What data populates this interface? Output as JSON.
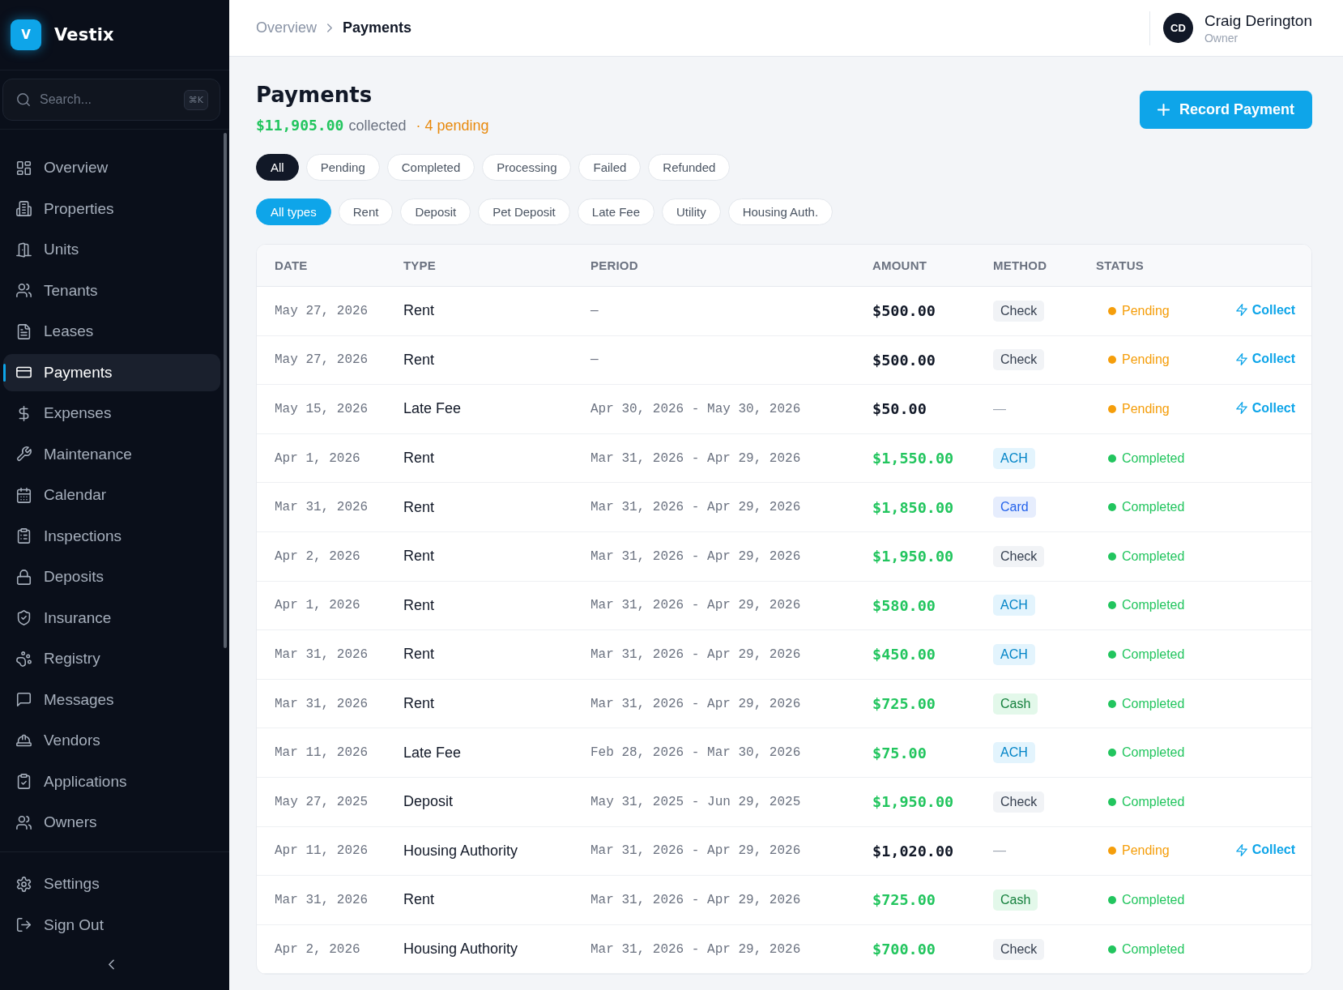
{
  "sidebar": {
    "logo": {
      "mark": "V",
      "name": "Vestix"
    },
    "search": {
      "placeholder": "Search...",
      "shortcut": "⌘K"
    },
    "nav": [
      {
        "label": "Overview",
        "selected": false
      },
      {
        "label": "Properties",
        "selected": false
      },
      {
        "label": "Units",
        "selected": false
      },
      {
        "label": "Tenants",
        "selected": false
      },
      {
        "label": "Leases",
        "selected": false
      },
      {
        "label": "Payments",
        "selected": true
      },
      {
        "label": "Expenses",
        "selected": false
      },
      {
        "label": "Maintenance",
        "selected": false
      },
      {
        "label": "Calendar",
        "selected": false
      },
      {
        "label": "Inspections",
        "selected": false
      },
      {
        "label": "Deposits",
        "selected": false
      },
      {
        "label": "Insurance",
        "selected": false
      },
      {
        "label": "Registry",
        "selected": false
      },
      {
        "label": "Messages",
        "selected": false
      },
      {
        "label": "Vendors",
        "selected": false
      },
      {
        "label": "Applications",
        "selected": false
      },
      {
        "label": "Owners",
        "selected": false
      }
    ],
    "footer_nav": [
      {
        "label": "Settings"
      },
      {
        "label": "Sign Out"
      }
    ]
  },
  "header": {
    "breadcrumb": [
      "Overview",
      "Payments"
    ],
    "user": {
      "initials": "CD",
      "name": "Craig Derington",
      "role": "Owner"
    }
  },
  "page": {
    "title": "Payments",
    "collected_amount": "$11,905.00",
    "collected_label": "collected",
    "pending": "· 4 pending",
    "primary_button": "Record Payment"
  },
  "status_filters": [
    {
      "label": "All",
      "selected": true
    },
    {
      "label": "Pending",
      "selected": false
    },
    {
      "label": "Completed",
      "selected": false
    },
    {
      "label": "Processing",
      "selected": false
    },
    {
      "label": "Failed",
      "selected": false
    },
    {
      "label": "Refunded",
      "selected": false
    }
  ],
  "type_filters": [
    {
      "label": "All types",
      "selected": true
    },
    {
      "label": "Rent",
      "selected": false
    },
    {
      "label": "Deposit",
      "selected": false
    },
    {
      "label": "Pet Deposit",
      "selected": false
    },
    {
      "label": "Late Fee",
      "selected": false
    },
    {
      "label": "Utility",
      "selected": false
    },
    {
      "label": "Housing Auth.",
      "selected": false
    }
  ],
  "table": {
    "columns": [
      "DATE",
      "TYPE",
      "PERIOD",
      "AMOUNT",
      "METHOD",
      "STATUS"
    ],
    "rows": [
      {
        "date": "May 27, 2026",
        "type": "Rent",
        "period": "—",
        "amount": "$500.00",
        "method": {
          "label": "Check",
          "kind": "check"
        },
        "status": {
          "label": "Pending",
          "kind": "pending"
        },
        "action": "Collect"
      },
      {
        "date": "May 27, 2026",
        "type": "Rent",
        "period": "—",
        "amount": "$500.00",
        "method": {
          "label": "Check",
          "kind": "check"
        },
        "status": {
          "label": "Pending",
          "kind": "pending"
        },
        "action": "Collect"
      },
      {
        "date": "May 15, 2026",
        "type": "Late Fee",
        "period": "Apr 30, 2026 - May 30, 2026",
        "amount": "$50.00",
        "method": {
          "label": "—",
          "kind": "none"
        },
        "status": {
          "label": "Pending",
          "kind": "pending"
        },
        "action": "Collect"
      },
      {
        "date": "Apr 1, 2026",
        "type": "Rent",
        "period": "Mar 31, 2026 - Apr 29, 2026",
        "amount": "$1,550.00",
        "method": {
          "label": "ACH",
          "kind": "ach"
        },
        "status": {
          "label": "Completed",
          "kind": "completed"
        }
      },
      {
        "date": "Mar 31, 2026",
        "type": "Rent",
        "period": "Mar 31, 2026 - Apr 29, 2026",
        "amount": "$1,850.00",
        "method": {
          "label": "Card",
          "kind": "card"
        },
        "status": {
          "label": "Completed",
          "kind": "completed"
        }
      },
      {
        "date": "Apr 2, 2026",
        "type": "Rent",
        "period": "Mar 31, 2026 - Apr 29, 2026",
        "amount": "$1,950.00",
        "method": {
          "label": "Check",
          "kind": "check"
        },
        "status": {
          "label": "Completed",
          "kind": "completed"
        }
      },
      {
        "date": "Apr 1, 2026",
        "type": "Rent",
        "period": "Mar 31, 2026 - Apr 29, 2026",
        "amount": "$580.00",
        "method": {
          "label": "ACH",
          "kind": "ach"
        },
        "status": {
          "label": "Completed",
          "kind": "completed"
        }
      },
      {
        "date": "Mar 31, 2026",
        "type": "Rent",
        "period": "Mar 31, 2026 - Apr 29, 2026",
        "amount": "$450.00",
        "method": {
          "label": "ACH",
          "kind": "ach"
        },
        "status": {
          "label": "Completed",
          "kind": "completed"
        }
      },
      {
        "date": "Mar 31, 2026",
        "type": "Rent",
        "period": "Mar 31, 2026 - Apr 29, 2026",
        "amount": "$725.00",
        "method": {
          "label": "Cash",
          "kind": "cash"
        },
        "status": {
          "label": "Completed",
          "kind": "completed"
        }
      },
      {
        "date": "Mar 11, 2026",
        "type": "Late Fee",
        "period": "Feb 28, 2026 - Mar 30, 2026",
        "amount": "$75.00",
        "method": {
          "label": "ACH",
          "kind": "ach"
        },
        "status": {
          "label": "Completed",
          "kind": "completed"
        }
      },
      {
        "date": "May 27, 2025",
        "type": "Deposit",
        "period": "May 31, 2025 - Jun 29, 2025",
        "amount": "$1,950.00",
        "method": {
          "label": "Check",
          "kind": "check"
        },
        "status": {
          "label": "Completed",
          "kind": "completed"
        }
      },
      {
        "date": "Apr 11, 2026",
        "type": "Housing Authority",
        "period": "Mar 31, 2026 - Apr 29, 2026",
        "amount": "$1,020.00",
        "method": {
          "label": "—",
          "kind": "none"
        },
        "status": {
          "label": "Pending",
          "kind": "pending"
        },
        "action": "Collect"
      },
      {
        "date": "Mar 31, 2026",
        "type": "Rent",
        "period": "Mar 31, 2026 - Apr 29, 2026",
        "amount": "$725.00",
        "method": {
          "label": "Cash",
          "kind": "cash"
        },
        "status": {
          "label": "Completed",
          "kind": "completed"
        }
      },
      {
        "date": "Apr 2, 2026",
        "type": "Housing Authority",
        "period": "Mar 31, 2026 - Apr 29, 2026",
        "amount": "$700.00",
        "method": {
          "label": "Check",
          "kind": "check"
        },
        "status": {
          "label": "Completed",
          "kind": "completed"
        }
      }
    ]
  }
}
